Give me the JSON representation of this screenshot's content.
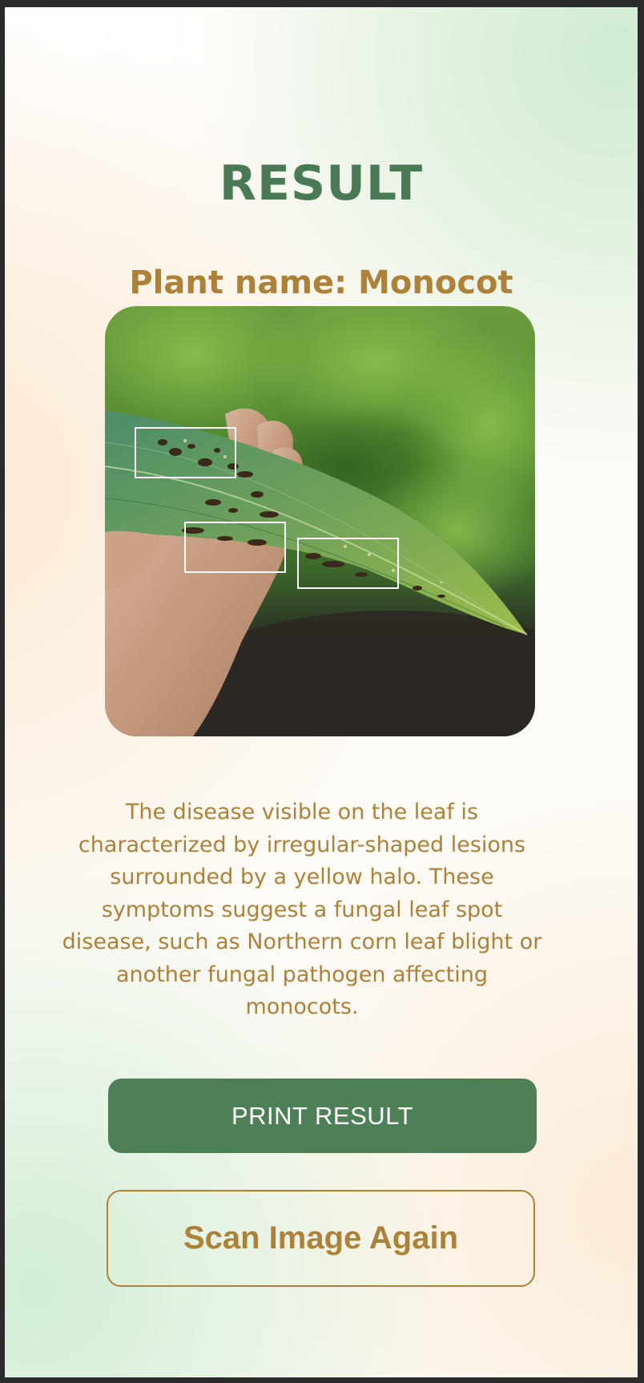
{
  "screen": {
    "title": "RESULT",
    "plant_name_label": "Plant name:",
    "plant_name_value": "Monocot",
    "image_alt": "Leaf with lesions held in hand",
    "detected_regions_count": 3,
    "description": "The disease visible on the leaf is characterized by irregular-shaped lesions surrounded by a yellow halo. These symptoms suggest a fungal leaf spot disease, such as Northern corn leaf blight or another fungal pathogen affecting monocots."
  },
  "actions": {
    "print_label": "PRINT RESULT",
    "scan_again_label": "Scan Image Again"
  },
  "colors": {
    "primary_green": "#4e8058",
    "title_green": "#4a7a55",
    "accent_gold": "#ad8138"
  }
}
